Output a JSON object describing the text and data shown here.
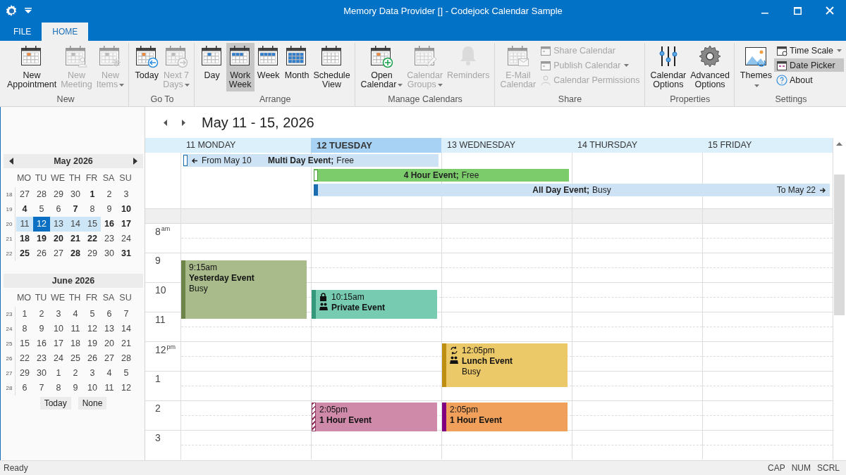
{
  "window": {
    "title": "Memory Data Provider [] -  Codejock Calendar Sample"
  },
  "tabs": [
    {
      "label": "FILE",
      "selected": false
    },
    {
      "label": "HOME",
      "selected": true
    }
  ],
  "ribbon": {
    "groups": [
      {
        "label": "New",
        "items": [
          {
            "kind": "large",
            "lines": [
              "New",
              "Appointment"
            ],
            "disabled": false,
            "dropdown": false,
            "selected": false
          },
          {
            "kind": "large",
            "lines": [
              "New",
              "Meeting"
            ],
            "disabled": true,
            "dropdown": false,
            "selected": false
          },
          {
            "kind": "large",
            "lines": [
              "New",
              "Items"
            ],
            "disabled": true,
            "dropdown": true,
            "selected": false
          }
        ]
      },
      {
        "label": "Go To",
        "items": [
          {
            "kind": "large",
            "lines": [
              "Today"
            ],
            "disabled": false,
            "dropdown": false,
            "selected": false
          },
          {
            "kind": "large",
            "lines": [
              "Next 7",
              "Days"
            ],
            "disabled": true,
            "dropdown": true,
            "selected": false
          }
        ]
      },
      {
        "label": "Arrange",
        "items": [
          {
            "kind": "large",
            "lines": [
              "Day"
            ],
            "disabled": false,
            "dropdown": false,
            "selected": false
          },
          {
            "kind": "large",
            "lines": [
              "Work",
              "Week"
            ],
            "disabled": false,
            "dropdown": false,
            "selected": true
          },
          {
            "kind": "large",
            "lines": [
              "Week"
            ],
            "disabled": false,
            "dropdown": false,
            "selected": false
          },
          {
            "kind": "large",
            "lines": [
              "Month"
            ],
            "disabled": false,
            "dropdown": false,
            "selected": false
          },
          {
            "kind": "large",
            "lines": [
              "Schedule",
              "View"
            ],
            "disabled": false,
            "dropdown": false,
            "selected": false
          }
        ]
      },
      {
        "label": "Manage Calendars",
        "items": [
          {
            "kind": "large",
            "lines": [
              "Open",
              "Calendar"
            ],
            "disabled": false,
            "dropdown": true,
            "selected": false
          },
          {
            "kind": "large",
            "lines": [
              "Calendar",
              "Groups"
            ],
            "disabled": true,
            "dropdown": true,
            "selected": false
          },
          {
            "kind": "large",
            "lines": [
              "Reminders"
            ],
            "disabled": true,
            "dropdown": false,
            "selected": false
          }
        ]
      },
      {
        "label": "Share",
        "items": [
          {
            "kind": "large",
            "lines": [
              "E-Mail",
              "Calendar"
            ],
            "disabled": true,
            "dropdown": false,
            "selected": false
          },
          {
            "kind": "small",
            "lines": [
              "Share Calendar"
            ],
            "disabled": true,
            "dropdown": false,
            "selected": false
          },
          {
            "kind": "small",
            "lines": [
              "Publish Calendar"
            ],
            "disabled": true,
            "dropdown": true,
            "selected": false
          },
          {
            "kind": "small",
            "lines": [
              "Calendar Permissions"
            ],
            "disabled": true,
            "dropdown": false,
            "selected": false
          }
        ]
      },
      {
        "label": "Properties",
        "items": [
          {
            "kind": "large",
            "lines": [
              "Calendar",
              "Options"
            ],
            "disabled": false,
            "dropdown": false,
            "selected": false
          },
          {
            "kind": "large",
            "lines": [
              "Advanced",
              "Options"
            ],
            "disabled": false,
            "dropdown": false,
            "selected": false
          }
        ]
      },
      {
        "label": "Settings",
        "items": [
          {
            "kind": "large",
            "lines": [
              "Themes"
            ],
            "disabled": false,
            "dropdown": true,
            "selected": false
          },
          {
            "kind": "small",
            "lines": [
              "Time Scale"
            ],
            "disabled": false,
            "dropdown": true,
            "selected": false
          },
          {
            "kind": "small",
            "lines": [
              "Date Picker"
            ],
            "disabled": false,
            "dropdown": false,
            "selected": true
          },
          {
            "kind": "small",
            "lines": [
              "About"
            ],
            "disabled": false,
            "dropdown": false,
            "selected": false
          }
        ]
      }
    ]
  },
  "date_picker": {
    "months": [
      {
        "title": "May 2026",
        "navigation": true,
        "weekdays": [
          "MO",
          "TU",
          "WE",
          "TH",
          "FR",
          "SA",
          "SU"
        ],
        "weeks": [
          {
            "number": "18",
            "days": [
              {
                "day": "27",
                "bold": false,
                "selected": false,
                "in_range": false
              },
              {
                "day": "28",
                "bold": false,
                "selected": false,
                "in_range": false
              },
              {
                "day": "29",
                "bold": false,
                "selected": false,
                "in_range": false
              },
              {
                "day": "30",
                "bold": false,
                "selected": false,
                "in_range": false
              },
              {
                "day": "1",
                "bold": true,
                "selected": false,
                "in_range": false
              },
              {
                "day": "2",
                "bold": false,
                "selected": false,
                "in_range": false
              },
              {
                "day": "3",
                "bold": false,
                "selected": false,
                "in_range": false
              }
            ]
          },
          {
            "number": "19",
            "days": [
              {
                "day": "4",
                "bold": true,
                "selected": false,
                "in_range": false
              },
              {
                "day": "5",
                "bold": false,
                "selected": false,
                "in_range": false
              },
              {
                "day": "6",
                "bold": false,
                "selected": false,
                "in_range": false
              },
              {
                "day": "7",
                "bold": true,
                "selected": false,
                "in_range": false
              },
              {
                "day": "8",
                "bold": false,
                "selected": false,
                "in_range": false
              },
              {
                "day": "9",
                "bold": false,
                "selected": false,
                "in_range": false
              },
              {
                "day": "10",
                "bold": true,
                "selected": false,
                "in_range": false
              }
            ]
          },
          {
            "number": "20",
            "days": [
              {
                "day": "11",
                "bold": false,
                "selected": false,
                "in_range": true
              },
              {
                "day": "12",
                "bold": false,
                "selected": true,
                "in_range": true
              },
              {
                "day": "13",
                "bold": false,
                "selected": false,
                "in_range": true
              },
              {
                "day": "14",
                "bold": false,
                "selected": false,
                "in_range": true
              },
              {
                "day": "15",
                "bold": false,
                "selected": false,
                "in_range": true
              },
              {
                "day": "16",
                "bold": true,
                "selected": false,
                "in_range": false
              },
              {
                "day": "17",
                "bold": true,
                "selected": false,
                "in_range": false
              }
            ]
          },
          {
            "number": "21",
            "days": [
              {
                "day": "18",
                "bold": true,
                "selected": false,
                "in_range": false
              },
              {
                "day": "19",
                "bold": true,
                "selected": false,
                "in_range": false
              },
              {
                "day": "20",
                "bold": true,
                "selected": false,
                "in_range": false
              },
              {
                "day": "21",
                "bold": true,
                "selected": false,
                "in_range": false
              },
              {
                "day": "22",
                "bold": true,
                "selected": false,
                "in_range": false
              },
              {
                "day": "23",
                "bold": false,
                "selected": false,
                "in_range": false
              },
              {
                "day": "24",
                "bold": false,
                "selected": false,
                "in_range": false
              }
            ]
          },
          {
            "number": "22",
            "days": [
              {
                "day": "25",
                "bold": true,
                "selected": false,
                "in_range": false
              },
              {
                "day": "26",
                "bold": false,
                "selected": false,
                "in_range": false
              },
              {
                "day": "27",
                "bold": false,
                "selected": false,
                "in_range": false
              },
              {
                "day": "28",
                "bold": true,
                "selected": false,
                "in_range": false
              },
              {
                "day": "29",
                "bold": false,
                "selected": false,
                "in_range": false
              },
              {
                "day": "30",
                "bold": false,
                "selected": false,
                "in_range": false
              },
              {
                "day": "31",
                "bold": true,
                "selected": false,
                "in_range": false
              }
            ]
          }
        ]
      },
      {
        "title": "June 2026",
        "navigation": false,
        "weekdays": [
          "MO",
          "TU",
          "WE",
          "TH",
          "FR",
          "SA",
          "SU"
        ],
        "weeks": [
          {
            "number": "23",
            "days": [
              {
                "day": "1",
                "bold": false,
                "selected": false,
                "in_range": false
              },
              {
                "day": "2",
                "bold": false,
                "selected": false,
                "in_range": false
              },
              {
                "day": "3",
                "bold": false,
                "selected": false,
                "in_range": false
              },
              {
                "day": "4",
                "bold": false,
                "selected": false,
                "in_range": false
              },
              {
                "day": "5",
                "bold": false,
                "selected": false,
                "in_range": false
              },
              {
                "day": "6",
                "bold": false,
                "selected": false,
                "in_range": false
              },
              {
                "day": "7",
                "bold": false,
                "selected": false,
                "in_range": false
              }
            ]
          },
          {
            "number": "24",
            "days": [
              {
                "day": "8",
                "bold": false,
                "selected": false,
                "in_range": false
              },
              {
                "day": "9",
                "bold": false,
                "selected": false,
                "in_range": false
              },
              {
                "day": "10",
                "bold": false,
                "selected": false,
                "in_range": false
              },
              {
                "day": "11",
                "bold": false,
                "selected": false,
                "in_range": false
              },
              {
                "day": "12",
                "bold": false,
                "selected": false,
                "in_range": false
              },
              {
                "day": "13",
                "bold": false,
                "selected": false,
                "in_range": false
              },
              {
                "day": "14",
                "bold": false,
                "selected": false,
                "in_range": false
              }
            ]
          },
          {
            "number": "25",
            "days": [
              {
                "day": "15",
                "bold": false,
                "selected": false,
                "in_range": false
              },
              {
                "day": "16",
                "bold": false,
                "selected": false,
                "in_range": false
              },
              {
                "day": "17",
                "bold": false,
                "selected": false,
                "in_range": false
              },
              {
                "day": "18",
                "bold": false,
                "selected": false,
                "in_range": false
              },
              {
                "day": "19",
                "bold": false,
                "selected": false,
                "in_range": false
              },
              {
                "day": "20",
                "bold": false,
                "selected": false,
                "in_range": false
              },
              {
                "day": "21",
                "bold": false,
                "selected": false,
                "in_range": false
              }
            ]
          },
          {
            "number": "26",
            "days": [
              {
                "day": "22",
                "bold": false,
                "selected": false,
                "in_range": false
              },
              {
                "day": "23",
                "bold": false,
                "selected": false,
                "in_range": false
              },
              {
                "day": "24",
                "bold": false,
                "selected": false,
                "in_range": false
              },
              {
                "day": "25",
                "bold": false,
                "selected": false,
                "in_range": false
              },
              {
                "day": "26",
                "bold": false,
                "selected": false,
                "in_range": false
              },
              {
                "day": "27",
                "bold": false,
                "selected": false,
                "in_range": false
              },
              {
                "day": "28",
                "bold": false,
                "selected": false,
                "in_range": false
              }
            ]
          },
          {
            "number": "27",
            "days": [
              {
                "day": "29",
                "bold": false,
                "selected": false,
                "in_range": false
              },
              {
                "day": "30",
                "bold": false,
                "selected": false,
                "in_range": false
              },
              {
                "day": "1",
                "bold": false,
                "selected": false,
                "in_range": false
              },
              {
                "day": "2",
                "bold": false,
                "selected": false,
                "in_range": false
              },
              {
                "day": "3",
                "bold": false,
                "selected": false,
                "in_range": false
              },
              {
                "day": "4",
                "bold": false,
                "selected": false,
                "in_range": false
              },
              {
                "day": "5",
                "bold": false,
                "selected": false,
                "in_range": false
              }
            ]
          },
          {
            "number": "28",
            "days": [
              {
                "day": "6",
                "bold": false,
                "selected": false,
                "in_range": false
              },
              {
                "day": "7",
                "bold": false,
                "selected": false,
                "in_range": false
              },
              {
                "day": "8",
                "bold": false,
                "selected": false,
                "in_range": false
              },
              {
                "day": "9",
                "bold": false,
                "selected": false,
                "in_range": false
              },
              {
                "day": "10",
                "bold": false,
                "selected": false,
                "in_range": false
              },
              {
                "day": "11",
                "bold": false,
                "selected": false,
                "in_range": false
              },
              {
                "day": "12",
                "bold": false,
                "selected": false,
                "in_range": false
              }
            ]
          }
        ]
      }
    ],
    "buttons": [
      "Today",
      "None"
    ]
  },
  "calendar": {
    "title": "May 11 - 15, 2026",
    "days": [
      {
        "label": "11 MONDAY",
        "selected": false
      },
      {
        "label": "12 TUESDAY",
        "selected": true
      },
      {
        "label": "13 WEDNESDAY",
        "selected": false
      },
      {
        "label": "14 THURSDAY",
        "selected": false
      },
      {
        "label": "15 FRIDAY",
        "selected": false
      }
    ],
    "all_day_events": [
      {
        "continues_from": "From May 10",
        "title": "Multi Day Event;",
        "status": "Free",
        "kind": "free",
        "color": "#cde3f5"
      },
      {
        "title": "4 Hour Event;",
        "status": "Free",
        "kind": "free",
        "color": "#7ccc6c"
      },
      {
        "title": "All Day Event;",
        "status": "Busy",
        "continues_to": "To May 22",
        "kind": "busy",
        "color": "#cde3f5"
      }
    ],
    "hours": [
      {
        "hour": "8",
        "suffix": "am"
      },
      {
        "hour": "9"
      },
      {
        "hour": "10"
      },
      {
        "hour": "11"
      },
      {
        "hour": "12",
        "suffix": "pm"
      },
      {
        "hour": "1"
      },
      {
        "hour": "2"
      },
      {
        "hour": "3"
      }
    ],
    "events": [
      {
        "time": "9:15am",
        "title": "Yesterday Event",
        "status": "Busy",
        "kind": "busy",
        "color": "#a9bb8b",
        "private": false,
        "meeting": false,
        "recurring": false
      },
      {
        "time": "10:15am",
        "title": "Private Event",
        "kind": "busy",
        "color": "#76cbb1",
        "private": true,
        "meeting": true,
        "recurring": false
      },
      {
        "time": "12:05pm",
        "title": "Lunch Event",
        "status": "Busy",
        "kind": "busy",
        "color": "#ecc968",
        "private": false,
        "meeting": true,
        "recurring": true
      },
      {
        "time": "2:05pm",
        "title": "1 Hour Event",
        "kind": "tentative",
        "color": "#cf8aaa",
        "private": false,
        "meeting": false,
        "recurring": false
      },
      {
        "time": "2:05pm",
        "title": "1 Hour Event",
        "kind": "out_of_office",
        "color": "#f0a05a",
        "private": false,
        "meeting": false,
        "recurring": false
      }
    ]
  },
  "status_bar": {
    "text": "Ready",
    "indicators": [
      "CAP",
      "NUM",
      "SCRL"
    ]
  }
}
